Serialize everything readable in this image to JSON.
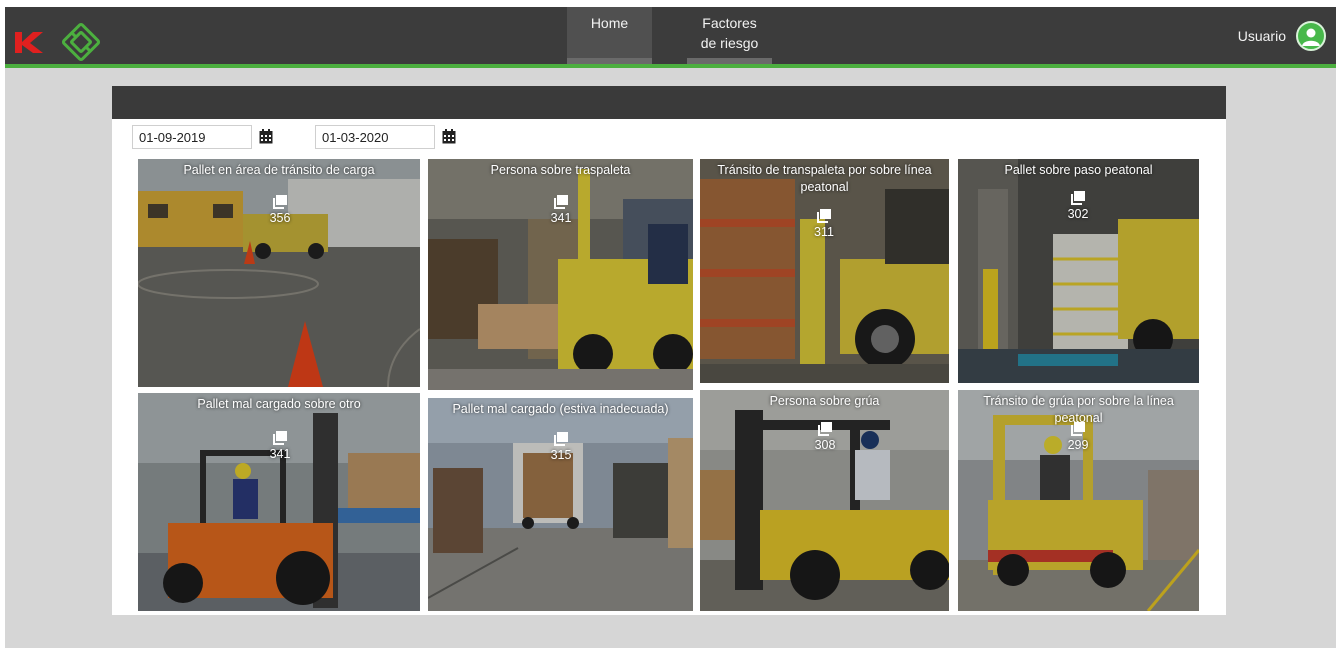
{
  "nav": {
    "home": "Home",
    "factores_line1": "Factores",
    "factores_line2": "de riesgo",
    "user_label": "Usuario",
    "user_icon": "user-circle-icon"
  },
  "filters": {
    "date_from": "01-09-2019",
    "date_to": "01-03-2020",
    "calendar_icon": "calendar-icon"
  },
  "colors": {
    "accent_green": "#4caf3f",
    "logo_red": "#e0201f",
    "topbar": "#3c3c3c"
  },
  "tiles": [
    {
      "title": "Pallet en área de tránsito de carga",
      "count": "356",
      "icon": "images-icon"
    },
    {
      "title": "Persona sobre traspaleta",
      "count": "341",
      "icon": "images-icon"
    },
    {
      "title": "Tránsito de transpaleta por sobre línea peatonal",
      "count": "311",
      "icon": "images-icon"
    },
    {
      "title": "Pallet sobre paso peatonal",
      "count": "302",
      "icon": "images-icon"
    },
    {
      "title": "Pallet mal cargado sobre otro",
      "count": "341",
      "icon": "images-icon"
    },
    {
      "title": "Pallet mal cargado (estiva inadecuada)",
      "count": "315",
      "icon": "images-icon"
    },
    {
      "title": "Persona sobre grúa",
      "count": "308",
      "icon": "images-icon"
    },
    {
      "title": "Tránsito de grúa por sobre la línea peatonal",
      "count": "299",
      "icon": "images-icon"
    }
  ]
}
